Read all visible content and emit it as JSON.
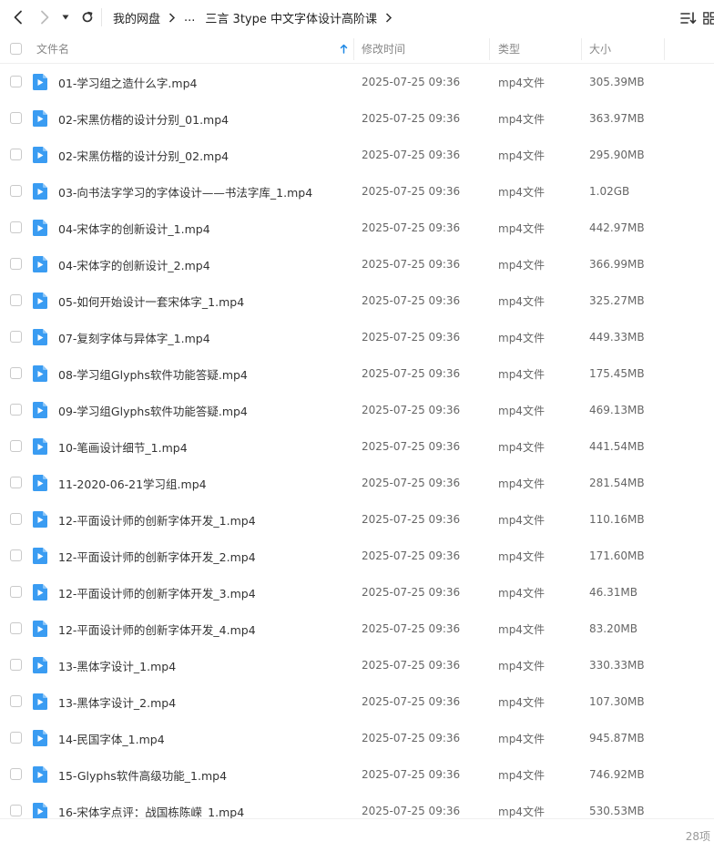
{
  "breadcrumb": {
    "root": "我的网盘",
    "ellipsis": "...",
    "current": "三言 3type 中文字体设计高阶课"
  },
  "icons": {
    "back": "chevron-left-icon",
    "forward": "chevron-right-icon",
    "dropdown": "caret-down-icon",
    "refresh": "refresh-icon",
    "sort": "sort-list-icon",
    "grid": "grid-view-icon",
    "file": "video-file-icon"
  },
  "colors": {
    "accent": "#1e88e5",
    "file_icon": "#3a9cf2"
  },
  "columns": {
    "name": "文件名",
    "modified": "修改时间",
    "type": "类型",
    "size": "大小"
  },
  "files": [
    {
      "name": "01-学习组之造什么字.mp4",
      "modified": "2025-07-25 09:36",
      "type": "mp4文件",
      "size": "305.39MB"
    },
    {
      "name": "02-宋黑仿楷的设计分别_01.mp4",
      "modified": "2025-07-25 09:36",
      "type": "mp4文件",
      "size": "363.97MB"
    },
    {
      "name": "02-宋黑仿楷的设计分别_02.mp4",
      "modified": "2025-07-25 09:36",
      "type": "mp4文件",
      "size": "295.90MB"
    },
    {
      "name": "03-向书法字学习的字体设计——书法字库_1.mp4",
      "modified": "2025-07-25 09:36",
      "type": "mp4文件",
      "size": "1.02GB"
    },
    {
      "name": "04-宋体字的创新设计_1.mp4",
      "modified": "2025-07-25 09:36",
      "type": "mp4文件",
      "size": "442.97MB"
    },
    {
      "name": "04-宋体字的创新设计_2.mp4",
      "modified": "2025-07-25 09:36",
      "type": "mp4文件",
      "size": "366.99MB"
    },
    {
      "name": "05-如何开始设计一套宋体字_1.mp4",
      "modified": "2025-07-25 09:36",
      "type": "mp4文件",
      "size": "325.27MB"
    },
    {
      "name": "07-复刻字体与异体字_1.mp4",
      "modified": "2025-07-25 09:36",
      "type": "mp4文件",
      "size": "449.33MB"
    },
    {
      "name": "08-学习组Glyphs软件功能答疑.mp4",
      "modified": "2025-07-25 09:36",
      "type": "mp4文件",
      "size": "175.45MB"
    },
    {
      "name": "09-学习组Glyphs软件功能答疑.mp4",
      "modified": "2025-07-25 09:36",
      "type": "mp4文件",
      "size": "469.13MB"
    },
    {
      "name": "10-笔画设计细节_1.mp4",
      "modified": "2025-07-25 09:36",
      "type": "mp4文件",
      "size": "441.54MB"
    },
    {
      "name": "11-2020-06-21学习组.mp4",
      "modified": "2025-07-25 09:36",
      "type": "mp4文件",
      "size": "281.54MB"
    },
    {
      "name": "12-平面设计师的创新字体开发_1.mp4",
      "modified": "2025-07-25 09:36",
      "type": "mp4文件",
      "size": "110.16MB"
    },
    {
      "name": "12-平面设计师的创新字体开发_2.mp4",
      "modified": "2025-07-25 09:36",
      "type": "mp4文件",
      "size": "171.60MB"
    },
    {
      "name": "12-平面设计师的创新字体开发_3.mp4",
      "modified": "2025-07-25 09:36",
      "type": "mp4文件",
      "size": "46.31MB"
    },
    {
      "name": "12-平面设计师的创新字体开发_4.mp4",
      "modified": "2025-07-25 09:36",
      "type": "mp4文件",
      "size": "83.20MB"
    },
    {
      "name": "13-黑体字设计_1.mp4",
      "modified": "2025-07-25 09:36",
      "type": "mp4文件",
      "size": "330.33MB"
    },
    {
      "name": "13-黑体字设计_2.mp4",
      "modified": "2025-07-25 09:36",
      "type": "mp4文件",
      "size": "107.30MB"
    },
    {
      "name": "14-民国字体_1.mp4",
      "modified": "2025-07-25 09:36",
      "type": "mp4文件",
      "size": "945.87MB"
    },
    {
      "name": "15-Glyphs软件高级功能_1.mp4",
      "modified": "2025-07-25 09:36",
      "type": "mp4文件",
      "size": "746.92MB"
    },
    {
      "name": "16-宋体字点评：战国栋陈嵘_1.mp4",
      "modified": "2025-07-25 09:36",
      "type": "mp4文件",
      "size": "530.53MB"
    }
  ],
  "footer": {
    "count": "28项"
  }
}
